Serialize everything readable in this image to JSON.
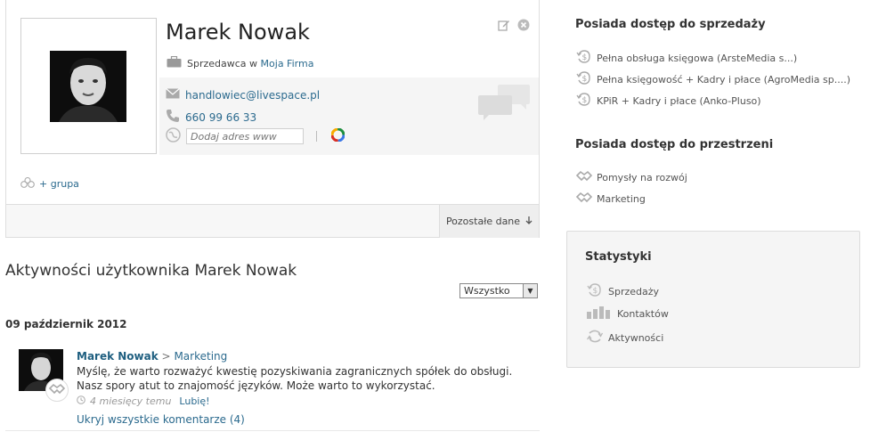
{
  "profile": {
    "name": "Marek Nowak",
    "role": "Sprzedawca",
    "role_connector": "w",
    "company": "Moja Firma",
    "email": "handlowiec@livespace.pl",
    "phone": "660 99 66 33",
    "www_placeholder": "Dodaj adres www",
    "group_label": "+ grupa",
    "more_data_label": "Pozostałe dane"
  },
  "activity": {
    "title": "Aktywności użytkownika Marek Nowak",
    "filter_value": "Wszystko",
    "date": "09 październik 2012",
    "entry": {
      "author": "Marek Nowak",
      "arrow": ">",
      "space": "Marketing",
      "text": "Myślę, że warto rozważyć kwestię pozyskiwania zagranicznych spółek do obsługi. Nasz spory atut to znajomość języków. Może warto to wykorzystać.",
      "time": "4 miesięcy temu",
      "like": "Lubię!",
      "hide_comments": "Ukryj wszystkie komentarze (4)"
    }
  },
  "sales_access": {
    "heading": "Posiada dostęp do sprzedaży",
    "items": [
      "Pełna obsługa księgowa (ArsteMedia s...)",
      "Pełna księgowość + Kadry i płace (AgroMedia sp....)",
      "KPiR + Kadry i płace (Anko-Pluso)"
    ]
  },
  "space_access": {
    "heading": "Posiada dostęp do przestrzeni",
    "items": [
      "Pomysły na rozwój",
      "Marketing"
    ]
  },
  "stats": {
    "title": "Statystyki",
    "items": [
      "Sprzedaży",
      "Kontaktów",
      "Aktywności"
    ]
  },
  "colors": {
    "link": "#2b6a8e",
    "author": "#1f5f80",
    "icon_gray": "#b5b5b5"
  }
}
